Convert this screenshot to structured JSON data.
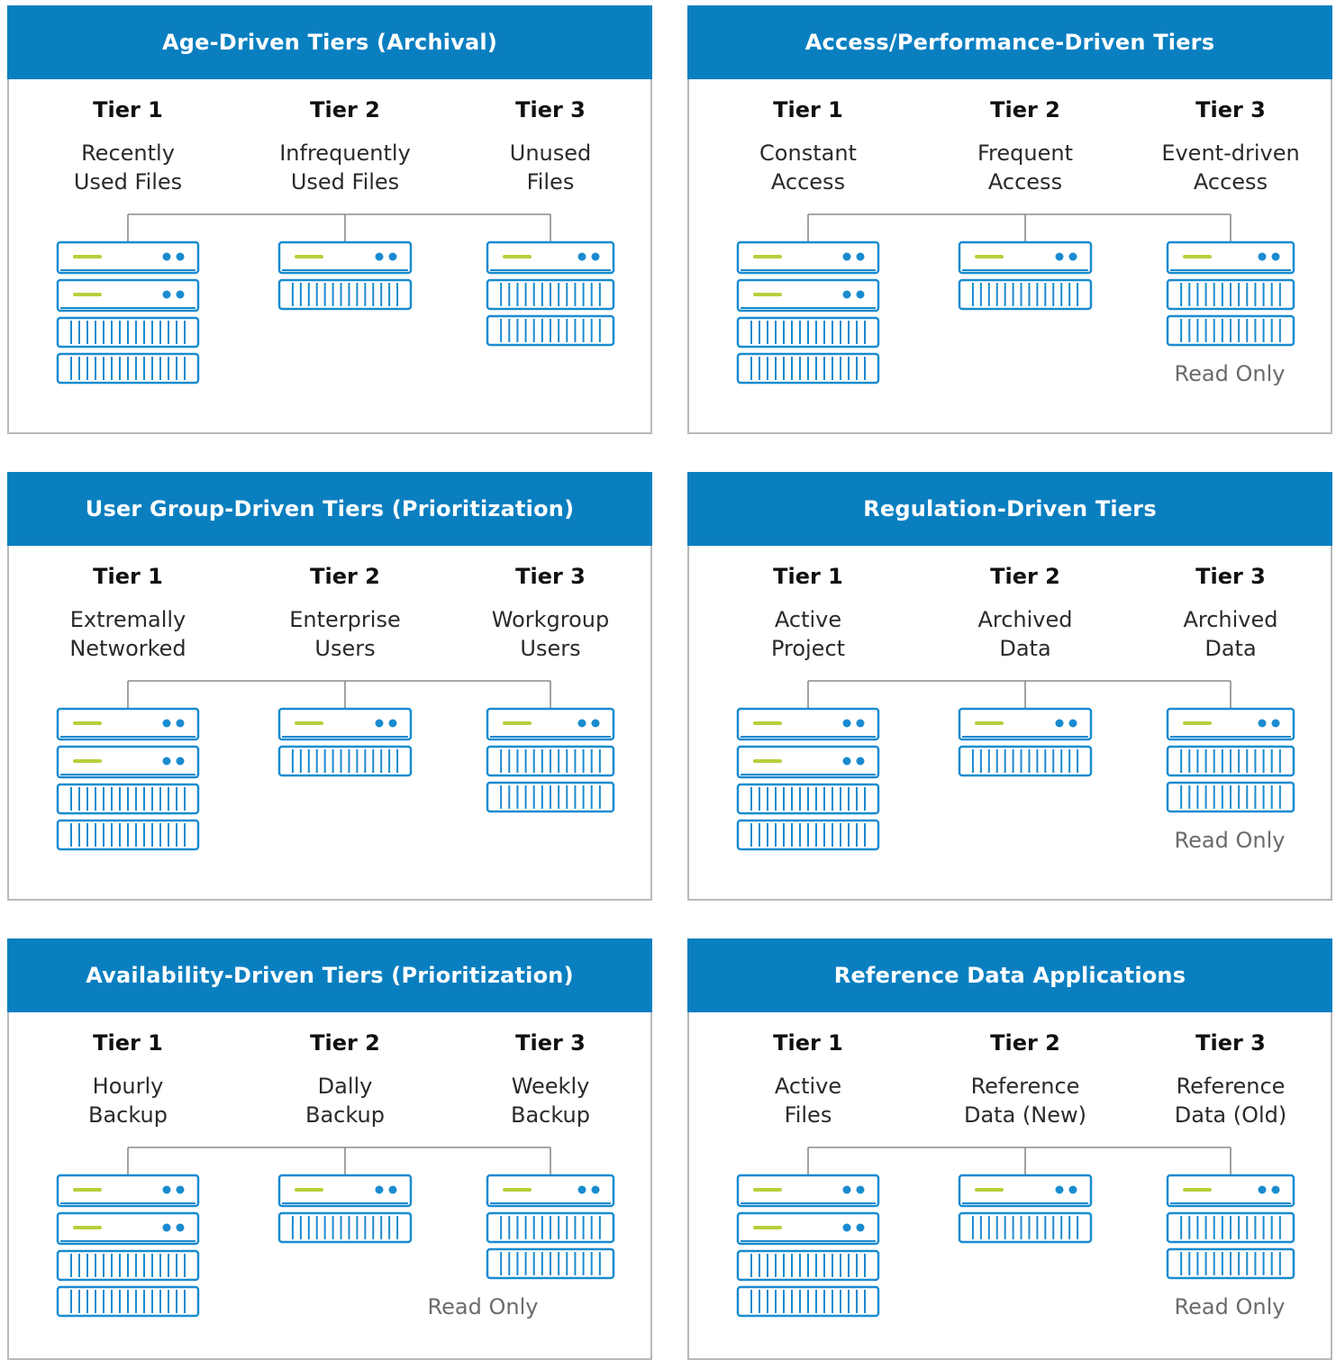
{
  "colors": {
    "header_bg": "#0a7fc0",
    "server_stroke": "#1a8bd0",
    "indicator_green": "#b7cf3a",
    "border": "#b9b9b9"
  },
  "panels": [
    {
      "title": "Age-Driven Tiers (Archival)",
      "tiers": [
        {
          "label": "Tier 1",
          "desc": [
            "Recently",
            "Used Files"
          ],
          "units": 4
        },
        {
          "label": "Tier 2",
          "desc": [
            "Infrequently",
            "Used Files"
          ],
          "units": 2
        },
        {
          "label": "Tier 3",
          "desc": [
            "Unused",
            "Files"
          ],
          "units": 3
        }
      ],
      "read_only": ""
    },
    {
      "title": "Access/Performance-Driven Tiers",
      "tiers": [
        {
          "label": "Tier 1",
          "desc": [
            "Constant",
            "Access"
          ],
          "units": 4
        },
        {
          "label": "Tier 2",
          "desc": [
            "Frequent",
            "Access"
          ],
          "units": 2
        },
        {
          "label": "Tier 3",
          "desc": [
            "Event-driven",
            "Access"
          ],
          "units": 3
        }
      ],
      "read_only": "Read Only"
    },
    {
      "title": "User Group-Driven Tiers (Prioritization)",
      "tiers": [
        {
          "label": "Tier 1",
          "desc": [
            "Extremally",
            "Networked"
          ],
          "units": 4
        },
        {
          "label": "Tier 2",
          "desc": [
            "Enterprise",
            "Users"
          ],
          "units": 2
        },
        {
          "label": "Tier 3",
          "desc": [
            "Workgroup",
            "Users"
          ],
          "units": 3
        }
      ],
      "read_only": ""
    },
    {
      "title": "Regulation-Driven Tiers",
      "tiers": [
        {
          "label": "Tier 1",
          "desc": [
            "Active",
            "Project"
          ],
          "units": 4
        },
        {
          "label": "Tier 2",
          "desc": [
            "Archived",
            "Data"
          ],
          "units": 2
        },
        {
          "label": "Tier 3",
          "desc": [
            "Archived",
            "Data"
          ],
          "units": 3
        }
      ],
      "read_only": "Read Only"
    },
    {
      "title": "Availability-Driven Tiers (Prioritization)",
      "tiers": [
        {
          "label": "Tier 1",
          "desc": [
            "Hourly",
            "Backup"
          ],
          "units": 4
        },
        {
          "label": "Tier 2",
          "desc": [
            "Dally",
            "Backup"
          ],
          "units": 2
        },
        {
          "label": "Tier 3",
          "desc": [
            "Weekly",
            "Backup"
          ],
          "units": 3
        }
      ],
      "read_only": "Read Only"
    },
    {
      "title": "Reference Data Applications",
      "tiers": [
        {
          "label": "Tier 1",
          "desc": [
            "Active",
            "Files"
          ],
          "units": 4
        },
        {
          "label": "Tier 2",
          "desc": [
            "Reference",
            "Data (New)"
          ],
          "units": 2
        },
        {
          "label": "Tier 3",
          "desc": [
            "Reference",
            "Data (Old)"
          ],
          "units": 3
        }
      ],
      "read_only": "Read Only"
    }
  ]
}
